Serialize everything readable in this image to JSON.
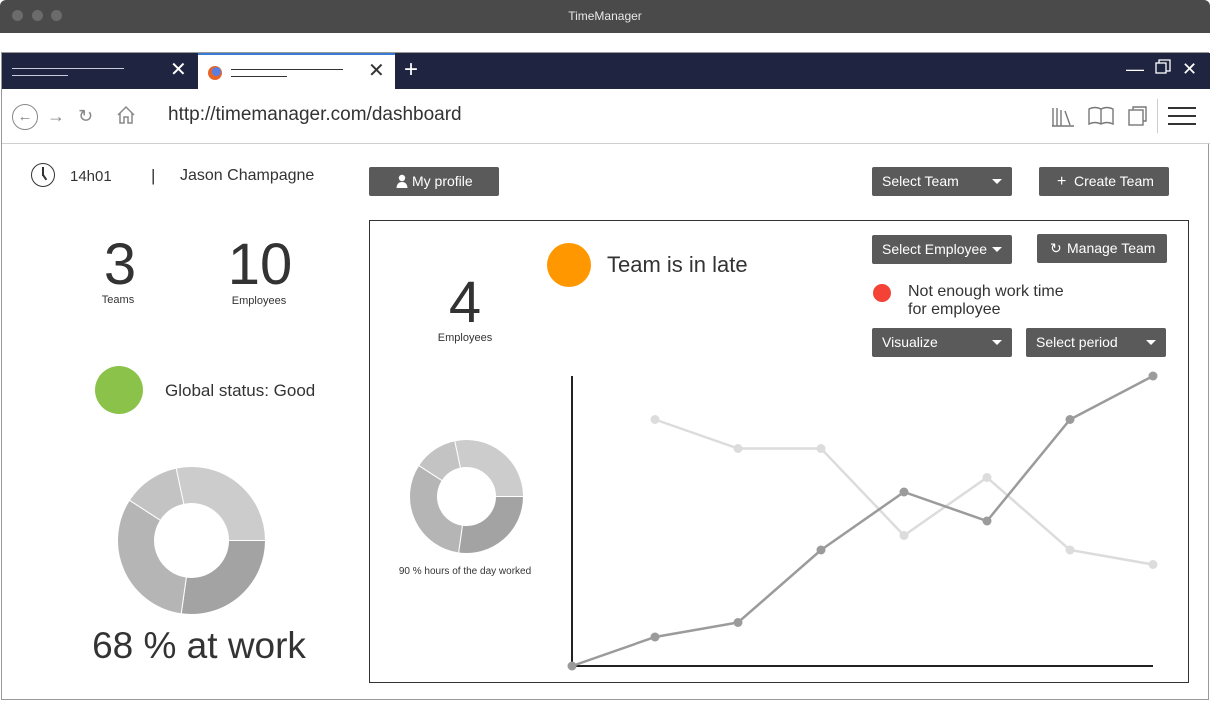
{
  "window": {
    "title": "TimeManager"
  },
  "browser": {
    "url": "http://timemanager.com/dashboard"
  },
  "header": {
    "time": "14h01",
    "separator": "|",
    "user_name": "Jason Champagne",
    "my_profile_label": "My profile",
    "select_team_label": "Select Team",
    "create_team_label": "Create Team"
  },
  "summary": {
    "teams_count": "3",
    "teams_label": "Teams",
    "employees_count": "10",
    "employees_label": "Employees",
    "global_status": "Global status: Good",
    "at_work_label": "68 % at work",
    "at_work_pct": 68
  },
  "team_panel": {
    "employees_count": "4",
    "employees_label": "Employees",
    "team_status": "Team is in late",
    "alert_line1": "Not enough work time",
    "alert_line2": "for employee",
    "select_employee_label": "Select Employee",
    "manage_team_label": "Manage Team",
    "visualize_label": "Visualize",
    "select_period_label": "Select period",
    "hours_worked_label": "90 % hours of the day worked",
    "hours_worked_pct": 90
  },
  "colors": {
    "status_good": "#8bc34a",
    "status_late": "#ff9800",
    "alert": "#f44336",
    "button_bg": "#5a5a5a",
    "tab_bar": "#1f2440"
  },
  "chart_data": {
    "type": "line",
    "x": [
      0,
      1,
      2,
      3,
      4,
      5,
      6,
      7
    ],
    "xlim": [
      0,
      7
    ],
    "ylim": [
      0,
      10
    ],
    "series": [
      {
        "values": [
          0,
          1,
          1.5,
          4,
          6,
          5,
          8.5,
          10
        ]
      },
      {
        "values": [
          null,
          8.5,
          7.5,
          7.5,
          4.5,
          6.5,
          4,
          3.5
        ]
      }
    ],
    "grid": false
  }
}
